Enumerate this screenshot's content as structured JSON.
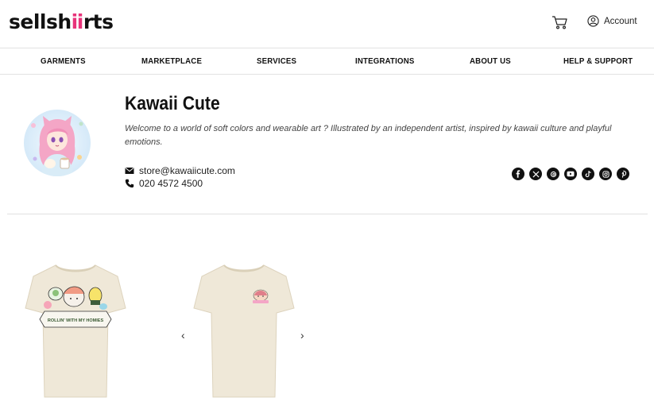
{
  "header": {
    "logo_left": "sellsh",
    "logo_mid": "i",
    "logo_right": "rts",
    "account_label": "Account"
  },
  "nav": {
    "items": [
      {
        "label": "GARMENTS"
      },
      {
        "label": "MARKETPLACE"
      },
      {
        "label": "SERVICES"
      },
      {
        "label": "INTEGRATIONS"
      },
      {
        "label": "ABOUT US"
      },
      {
        "label": "HELP & SUPPORT"
      }
    ]
  },
  "profile": {
    "name": "Kawaii Cute",
    "description": "Welcome to a world of soft colors and wearable art ? Illustrated by an independent artist, inspired by kawaii culture and playful emotions.",
    "email": "store@kawaiicute.com",
    "phone": "020 4572 4500",
    "socials": [
      "facebook-icon",
      "x-icon",
      "threads-icon",
      "youtube-icon",
      "tiktok-icon",
      "instagram-icon",
      "pinterest-icon"
    ]
  },
  "products": {
    "front_print_text": "ROLLIN' WITH MY HOMIES",
    "arrow_prev": "‹",
    "arrow_next": "›"
  },
  "colors": {
    "brand_pink": "#e8337a",
    "shirt": "#efe8d8",
    "text": "#111111"
  }
}
